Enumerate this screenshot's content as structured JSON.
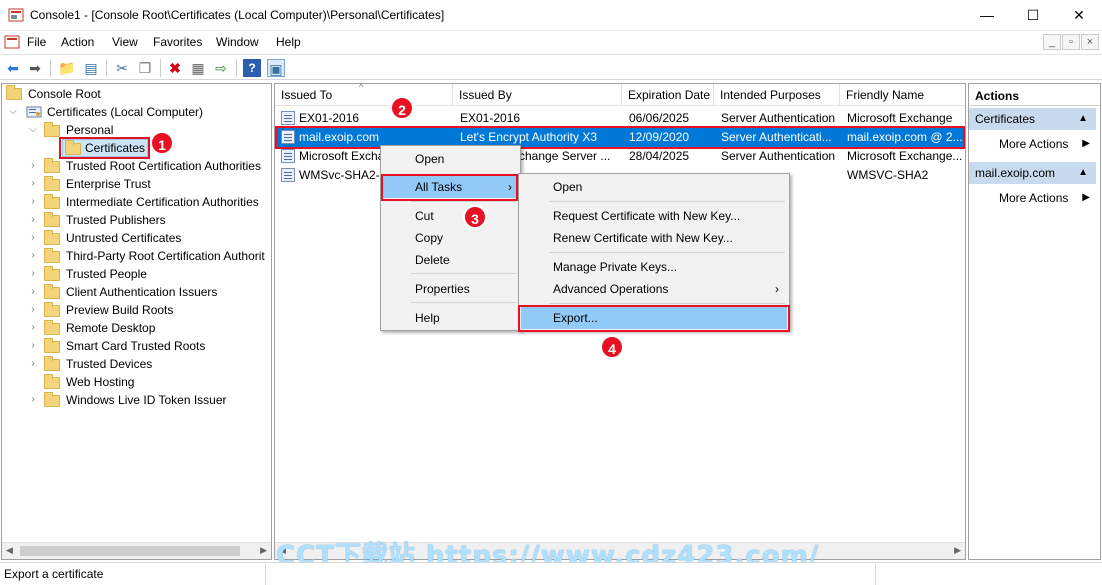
{
  "window": {
    "title": "Console1 - [Console Root\\Certificates (Local Computer)\\Personal\\Certificates]",
    "minimize": "—",
    "maximize": "☐",
    "close": "✕"
  },
  "menubar": [
    "File",
    "Action",
    "View",
    "Favorites",
    "Window",
    "Help"
  ],
  "tree": {
    "root": "Console Root",
    "computer": "Certificates (Local Computer)",
    "personal": "Personal",
    "selected": "Certificates",
    "stores": [
      "Trusted Root Certification Authorities",
      "Enterprise Trust",
      "Intermediate Certification Authorities",
      "Trusted Publishers",
      "Untrusted Certificates",
      "Third-Party Root Certification Authorit",
      "Trusted People",
      "Client Authentication Issuers",
      "Preview Build Roots",
      "Remote Desktop",
      "Smart Card Trusted Roots",
      "Trusted Devices",
      "Web Hosting",
      "Windows Live ID Token Issuer"
    ]
  },
  "list": {
    "columns": [
      "Issued To",
      "Issued By",
      "Expiration Date",
      "Intended Purposes",
      "Friendly Name"
    ],
    "rows": [
      {
        "issued_to": "EX01-2016",
        "issued_by": "EX01-2016",
        "expiration": "06/06/2025",
        "purposes": "Server Authentication",
        "friendly": "Microsoft Exchange"
      },
      {
        "issued_to": "mail.exoip.com",
        "issued_by": "Let's Encrypt Authority X3",
        "expiration": "12/09/2020",
        "purposes": "Server Authenticati...",
        "friendly": "mail.exoip.com @ 2..."
      },
      {
        "issued_to": "Microsoft Excha",
        "issued_by": "xchange Server ...",
        "expiration": "28/04/2025",
        "purposes": "Server Authentication",
        "friendly": "Microsoft Exchange..."
      },
      {
        "issued_to": "WMSvc-SHA2-E",
        "issued_by": "",
        "expiration": "",
        "purposes": "",
        "friendly": "WMSVC-SHA2"
      }
    ]
  },
  "context_menu": {
    "items": [
      "Open",
      "All Tasks",
      "Cut",
      "Copy",
      "Delete",
      "Properties",
      "Help"
    ]
  },
  "submenu": {
    "items": [
      "Open",
      "Request Certificate with New Key...",
      "Renew Certificate with New Key...",
      "Manage Private Keys...",
      "Advanced Operations",
      "Export..."
    ]
  },
  "actions": {
    "title": "Actions",
    "section1": "Certificates",
    "more1": "More Actions",
    "section2": "mail.exoip.com",
    "more2": "More Actions"
  },
  "badges": [
    "1",
    "2",
    "3",
    "4"
  ],
  "statusbar": {
    "text": "Export a certificate"
  },
  "watermark": "CCT下载站 https://www.cdz423.com/",
  "colors": {
    "selection": "#0078d7",
    "menu_highlight": "#91c9f7",
    "annotation_red": "#e81123",
    "actions_header": "#c8dbee"
  }
}
